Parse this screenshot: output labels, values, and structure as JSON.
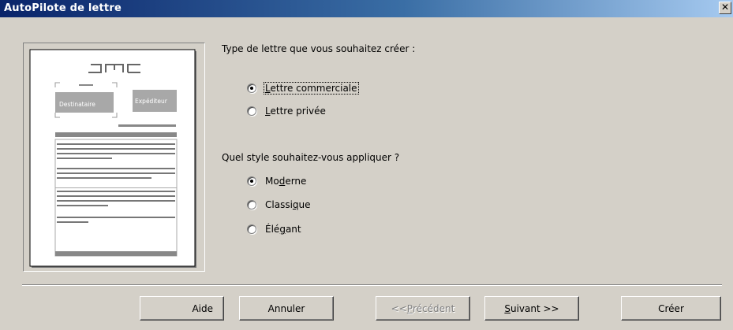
{
  "window": {
    "title": "AutoPilote de lettre",
    "close_glyph": "✕"
  },
  "preview": {
    "recipient_label": "Destinataire",
    "sender_label": "Expéditeur"
  },
  "letter_type": {
    "question": "Type de lettre que vous souhaitez créer :",
    "options": [
      {
        "label": "Lettre commerciale",
        "accel": "L",
        "checked": true
      },
      {
        "label": "Lettre privée",
        "accel": "L",
        "checked": false
      }
    ]
  },
  "style": {
    "question": "Quel style souhaitez-vous appliquer ?",
    "options": [
      {
        "label": "Moderne",
        "checked": true
      },
      {
        "label": "Classique",
        "checked": false
      },
      {
        "label": "Élégant",
        "checked": false
      }
    ]
  },
  "buttons": {
    "help": "Aide",
    "cancel": "Annuler",
    "previous": "<< Précédent",
    "next": "Suivant >>",
    "create": "Créer"
  },
  "colors": {
    "titlebar_start": "#0a246a",
    "titlebar_end": "#a6caf0",
    "dialog_bg": "#d4d0c8",
    "disabled_text": "#808080"
  }
}
